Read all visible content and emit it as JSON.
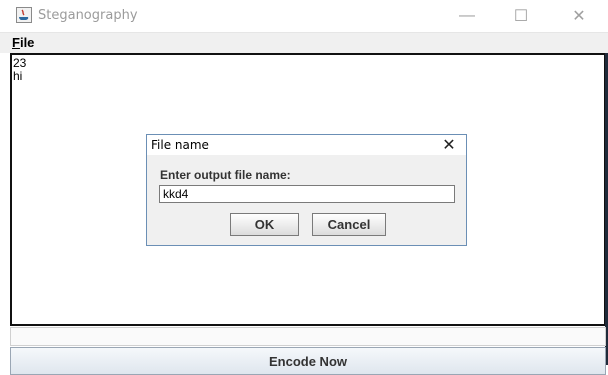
{
  "window": {
    "title": "Steganography",
    "icon": "java-app-icon",
    "minimize_glyph": "—",
    "maximize_glyph": "☐",
    "close_glyph": "✕"
  },
  "menu": {
    "file_mnemonic": "F",
    "file_rest": "ile"
  },
  "text_area": {
    "lines": [
      "23",
      "hi"
    ]
  },
  "dialog": {
    "title": "File name",
    "close_glyph": "✕",
    "prompt": "Enter output file name:",
    "input_value": "kkd4",
    "ok_label": "OK",
    "cancel_label": "Cancel"
  },
  "footer": {
    "encode_label": "Encode Now"
  }
}
